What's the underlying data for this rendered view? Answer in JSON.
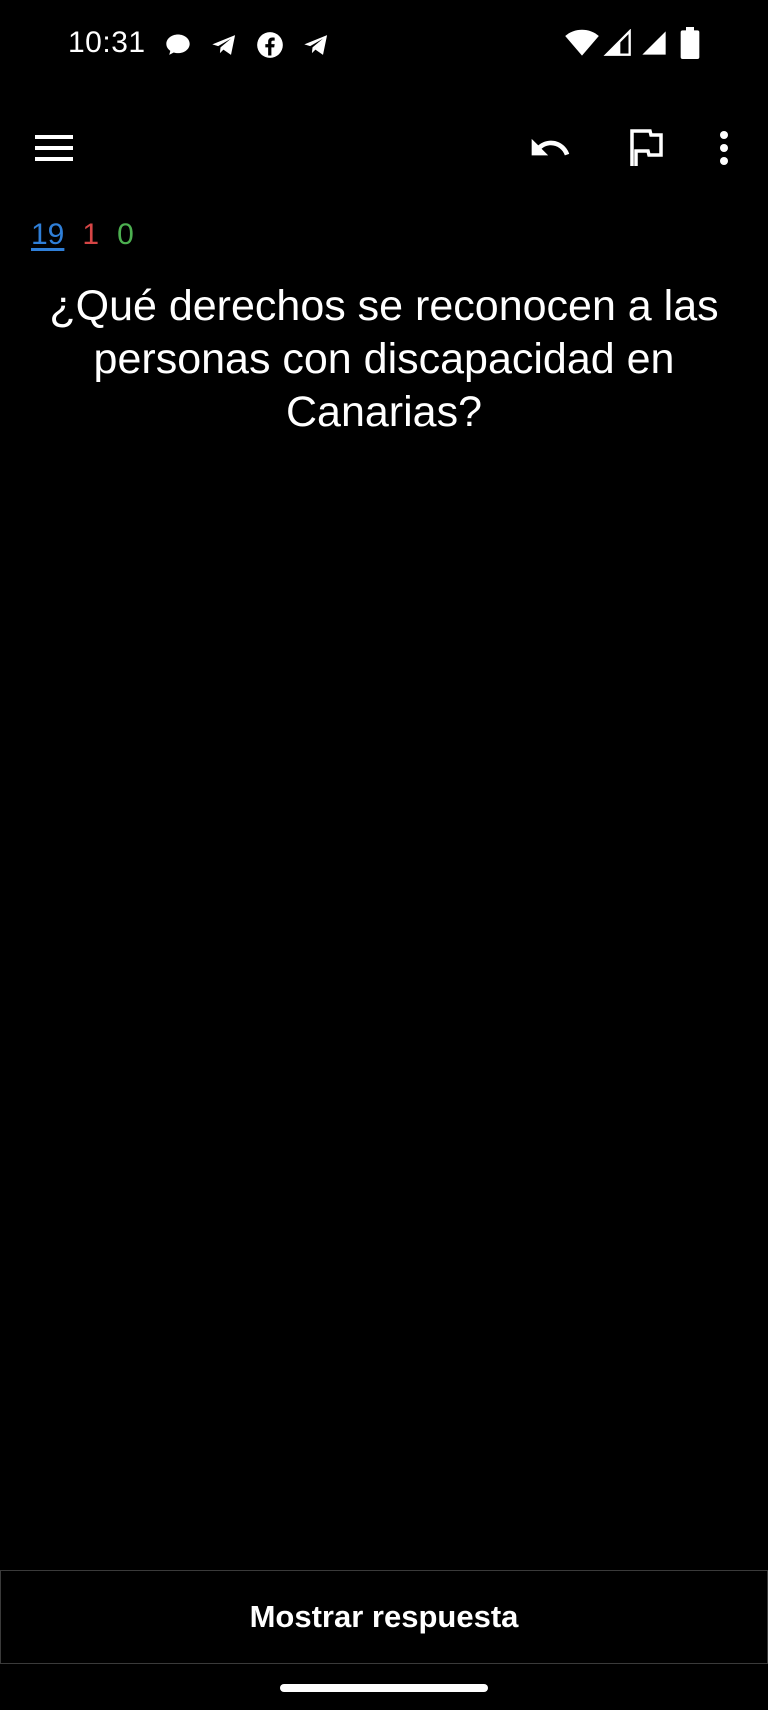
{
  "status_bar": {
    "time": "10:31",
    "notification_icons": [
      "chat-bubble-icon",
      "telegram-icon",
      "facebook-icon",
      "telegram-icon"
    ],
    "system_icons": [
      "wifi-icon",
      "cell-signal-icon",
      "cell-signal-icon",
      "battery-icon"
    ]
  },
  "app_bar": {
    "icons": [
      "menu-icon",
      "undo-icon",
      "flag-icon",
      "more-vertical-icon"
    ]
  },
  "counts": {
    "new": "19",
    "learning": "1",
    "review": "0",
    "colors": {
      "new": "#2f7fd8",
      "learning": "#d64545",
      "review": "#4caf50"
    }
  },
  "card": {
    "question": "¿Qué derechos se reconocen a las personas con discapacidad en Canarias?"
  },
  "footer": {
    "show_answer_label": "Mostrar respuesta"
  }
}
